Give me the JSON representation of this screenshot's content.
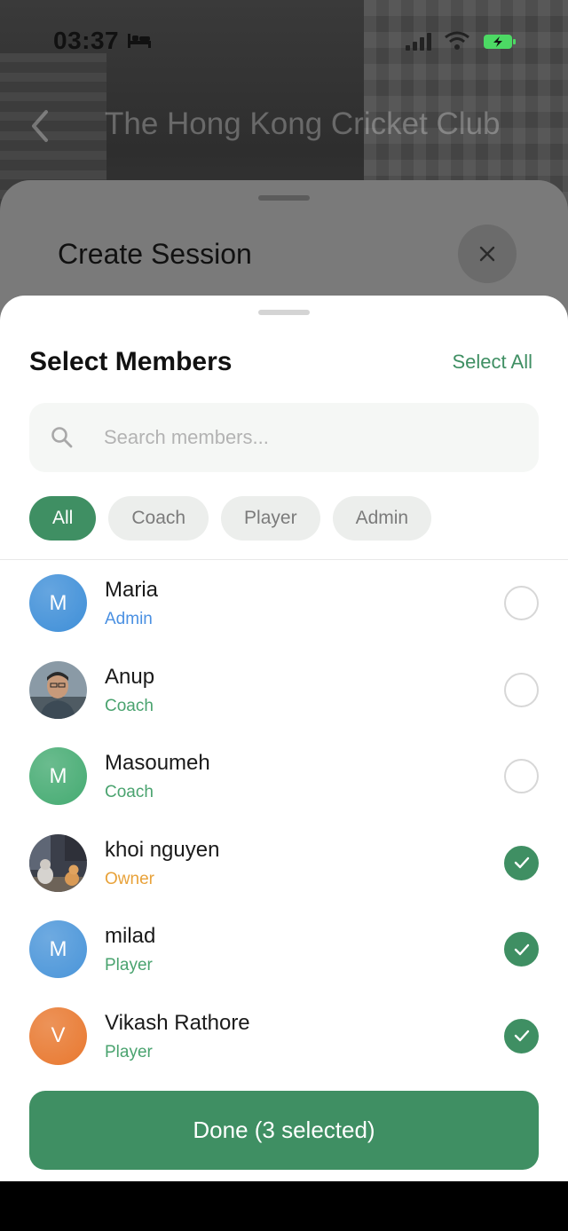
{
  "status_bar": {
    "time": "03:37"
  },
  "background": {
    "title": "The Hong Kong Cricket Club"
  },
  "create_session": {
    "title": "Create Session"
  },
  "select_members": {
    "title": "Select Members",
    "select_all_label": "Select All",
    "search": {
      "placeholder": "Search members...",
      "value": ""
    },
    "filters": [
      {
        "label": "All",
        "active": true
      },
      {
        "label": "Coach",
        "active": false
      },
      {
        "label": "Player",
        "active": false
      },
      {
        "label": "Admin",
        "active": false
      }
    ],
    "members": [
      {
        "initial": "M",
        "name": "Maria",
        "role": "Admin",
        "role_color": "#4a90e2",
        "avatar": "initial",
        "avatar_color": "#3f8fd8",
        "selected": false
      },
      {
        "initial": "",
        "name": "Anup",
        "role": "Coach",
        "role_color": "#4aa36f",
        "avatar": "photo-person",
        "avatar_color": "#6b7d8c",
        "selected": false
      },
      {
        "initial": "M",
        "name": "Masoumeh",
        "role": "Coach",
        "role_color": "#4aa36f",
        "avatar": "initial",
        "avatar_color": "#45ab72",
        "selected": false
      },
      {
        "initial": "",
        "name": "khoi nguyen",
        "role": "Owner",
        "role_color": "#e8a23a",
        "avatar": "photo-cats",
        "avatar_color": "#4b4b55",
        "selected": true
      },
      {
        "initial": "M",
        "name": "milad",
        "role": "Player",
        "role_color": "#4aa36f",
        "avatar": "initial",
        "avatar_color": "#4a95d9",
        "selected": true
      },
      {
        "initial": "V",
        "name": "Vikash Rathore",
        "role": "Player",
        "role_color": "#4aa36f",
        "avatar": "initial",
        "avatar_color": "#e8782f",
        "selected": true
      }
    ],
    "done_label": "Done (3 selected)"
  },
  "colors": {
    "accent": "#3f8f63"
  }
}
